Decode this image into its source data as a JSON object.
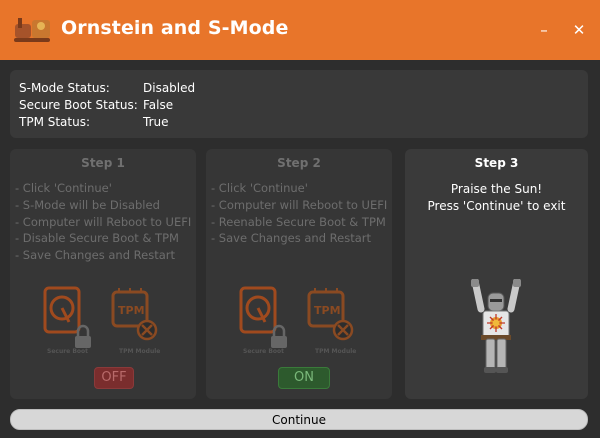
{
  "app": {
    "title": "Ornstein and S-Mode"
  },
  "window_controls": {
    "minimize": "–",
    "close": "✕"
  },
  "status": {
    "rows": [
      {
        "label": "S-Mode Status:",
        "value": "Disabled"
      },
      {
        "label": "Secure Boot Status:",
        "value": "False"
      },
      {
        "label": "TPM Status:",
        "value": "True"
      }
    ]
  },
  "steps": [
    {
      "title": "Step 1",
      "items": [
        "- Click 'Continue'",
        "- S-Mode will be Disabled",
        "- Computer will Reboot to UEFI",
        "- Disable Secure Boot & TPM",
        "- Save Changes and Restart"
      ],
      "illustration": {
        "left_label": "Secure Boot",
        "right_label": "TPM Module",
        "chip_text": "TPM",
        "toggle": "OFF"
      }
    },
    {
      "title": "Step 2",
      "items": [
        "- Click 'Continue'",
        "- Computer will Reboot to UEFI",
        "- Reenable Secure Boot & TPM",
        "- Save Changes and Restart"
      ],
      "illustration": {
        "left_label": "Secure Boot",
        "right_label": "TPM Module",
        "chip_text": "TPM",
        "toggle": "ON"
      }
    },
    {
      "title": "Step 3",
      "lines": [
        "Praise the Sun!",
        "Press 'Continue' to exit"
      ]
    }
  ],
  "continue_button": {
    "label": "Continue"
  },
  "colors": {
    "accent": "#e8752a",
    "background": "#2d2d2d",
    "panel": "#393939"
  }
}
